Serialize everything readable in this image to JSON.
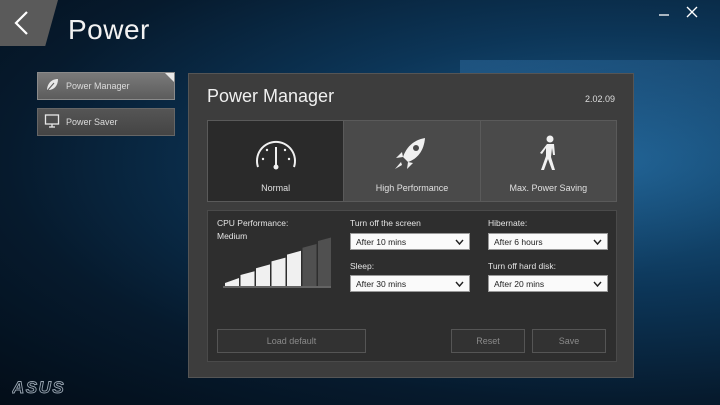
{
  "app": {
    "title": "Power",
    "brand": "ASUS"
  },
  "sidebar": {
    "items": [
      {
        "label": "Power Manager",
        "icon": "leaf-icon",
        "active": true
      },
      {
        "label": "Power Saver",
        "icon": "monitor-icon",
        "active": false
      }
    ]
  },
  "panel": {
    "title": "Power Manager",
    "version": "2.02.09",
    "modes": [
      {
        "label": "Normal",
        "icon": "gauge-icon",
        "selected": true
      },
      {
        "label": "High Performance",
        "icon": "rocket-icon",
        "selected": false
      },
      {
        "label": "Max. Power Saving",
        "icon": "walking-person-icon",
        "selected": false
      }
    ],
    "cpu": {
      "label": "CPU Performance:",
      "value": "Medium",
      "level": 5,
      "max_level": 7
    },
    "screen": {
      "label": "Turn off the screen",
      "value": "After 10 mins"
    },
    "hibernate": {
      "label": "Hibernate:",
      "value": "After 6 hours"
    },
    "sleep": {
      "label": "Sleep:",
      "value": "After 30 mins"
    },
    "harddisk": {
      "label": "Turn off hard disk:",
      "value": "After 20 mins"
    },
    "buttons": {
      "load_default": "Load default",
      "reset": "Reset",
      "save": "Save"
    }
  },
  "colors": {
    "selected_mode": "#2a2a2a",
    "panel_bg": "#3d3d3d",
    "bar_active": "#f0f0f0",
    "bar_inactive": "#505050"
  }
}
